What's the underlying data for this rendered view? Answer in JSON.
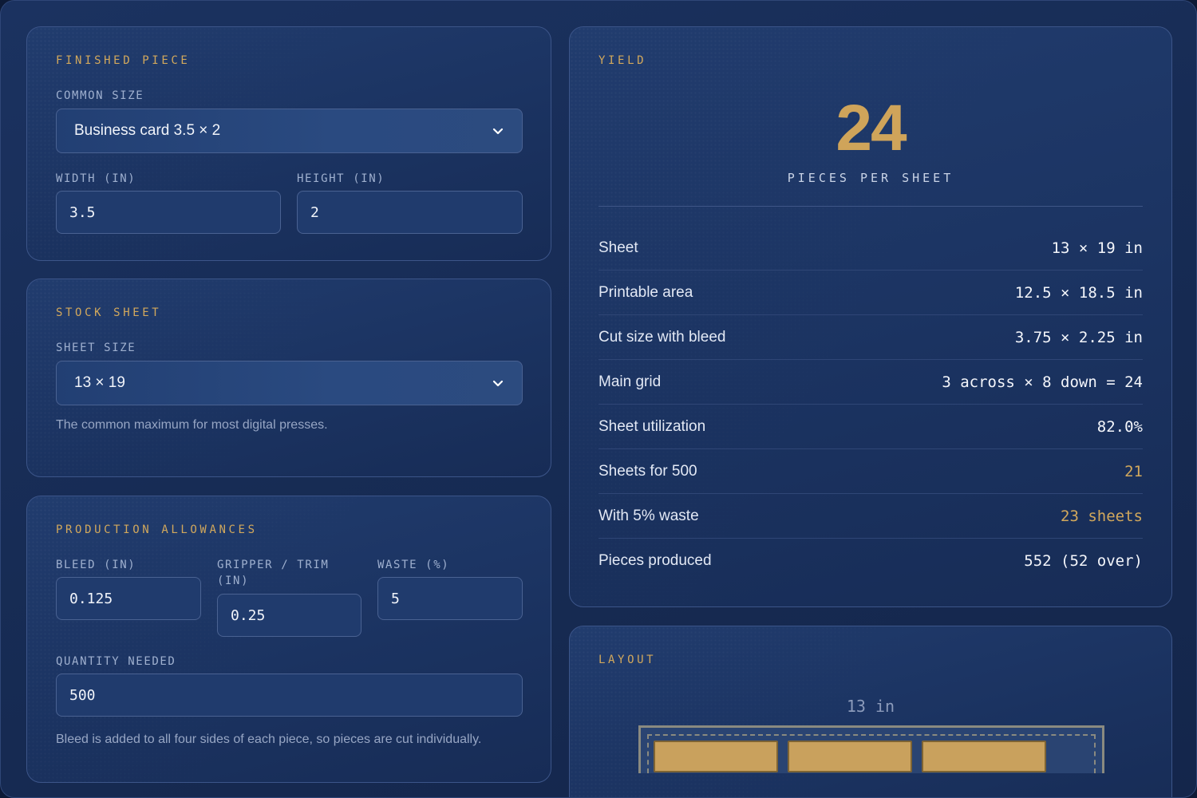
{
  "finished_piece": {
    "title": "FINISHED PIECE",
    "common_size_label": "COMMON SIZE",
    "common_size_value": "Business card 3.5 × 2",
    "width_label": "WIDTH (IN)",
    "width_value": "3.5",
    "height_label": "HEIGHT (IN)",
    "height_value": "2"
  },
  "stock_sheet": {
    "title": "STOCK SHEET",
    "sheet_size_label": "SHEET SIZE",
    "sheet_size_value": "13 × 19",
    "hint": "The common maximum for most digital presses."
  },
  "allowances": {
    "title": "PRODUCTION ALLOWANCES",
    "bleed_label": "BLEED (IN)",
    "bleed_value": "0.125",
    "gripper_label_1": "GRIPPER / TRIM",
    "gripper_label_2": "(IN)",
    "gripper_value": "0.25",
    "waste_label": "WASTE (%)",
    "waste_value": "5",
    "quantity_label": "QUANTITY NEEDED",
    "quantity_value": "500",
    "hint": "Bleed is added to all four sides of each piece, so pieces are cut individually."
  },
  "yield": {
    "title": "YIELD",
    "pieces_per_sheet": "24",
    "caption": "PIECES PER SHEET",
    "rows": [
      {
        "label": "Sheet",
        "value": "13 × 19 in",
        "accent": false
      },
      {
        "label": "Printable area",
        "value": "12.5 × 18.5 in",
        "accent": false
      },
      {
        "label": "Cut size with bleed",
        "value": "3.75 × 2.25 in",
        "accent": false
      },
      {
        "label": "Main grid",
        "value": "3 across × 8 down = 24",
        "accent": false
      },
      {
        "label": "Sheet utilization",
        "value": "82.0%",
        "accent": false
      },
      {
        "label": "Sheets for 500",
        "value": "21",
        "accent": true
      },
      {
        "label": "With 5% waste",
        "value": "23 sheets",
        "accent": true
      },
      {
        "label": "Pieces produced",
        "value": "552 (52 over)",
        "accent": false
      }
    ]
  },
  "layout": {
    "title": "LAYOUT",
    "sheet_width_label": "13 in"
  },
  "colors": {
    "accent": "#d2a85c",
    "background": "#172c55",
    "piece_fill": "#c9a15d"
  },
  "icons": {
    "select_chevron": "chevron-down-icon"
  }
}
